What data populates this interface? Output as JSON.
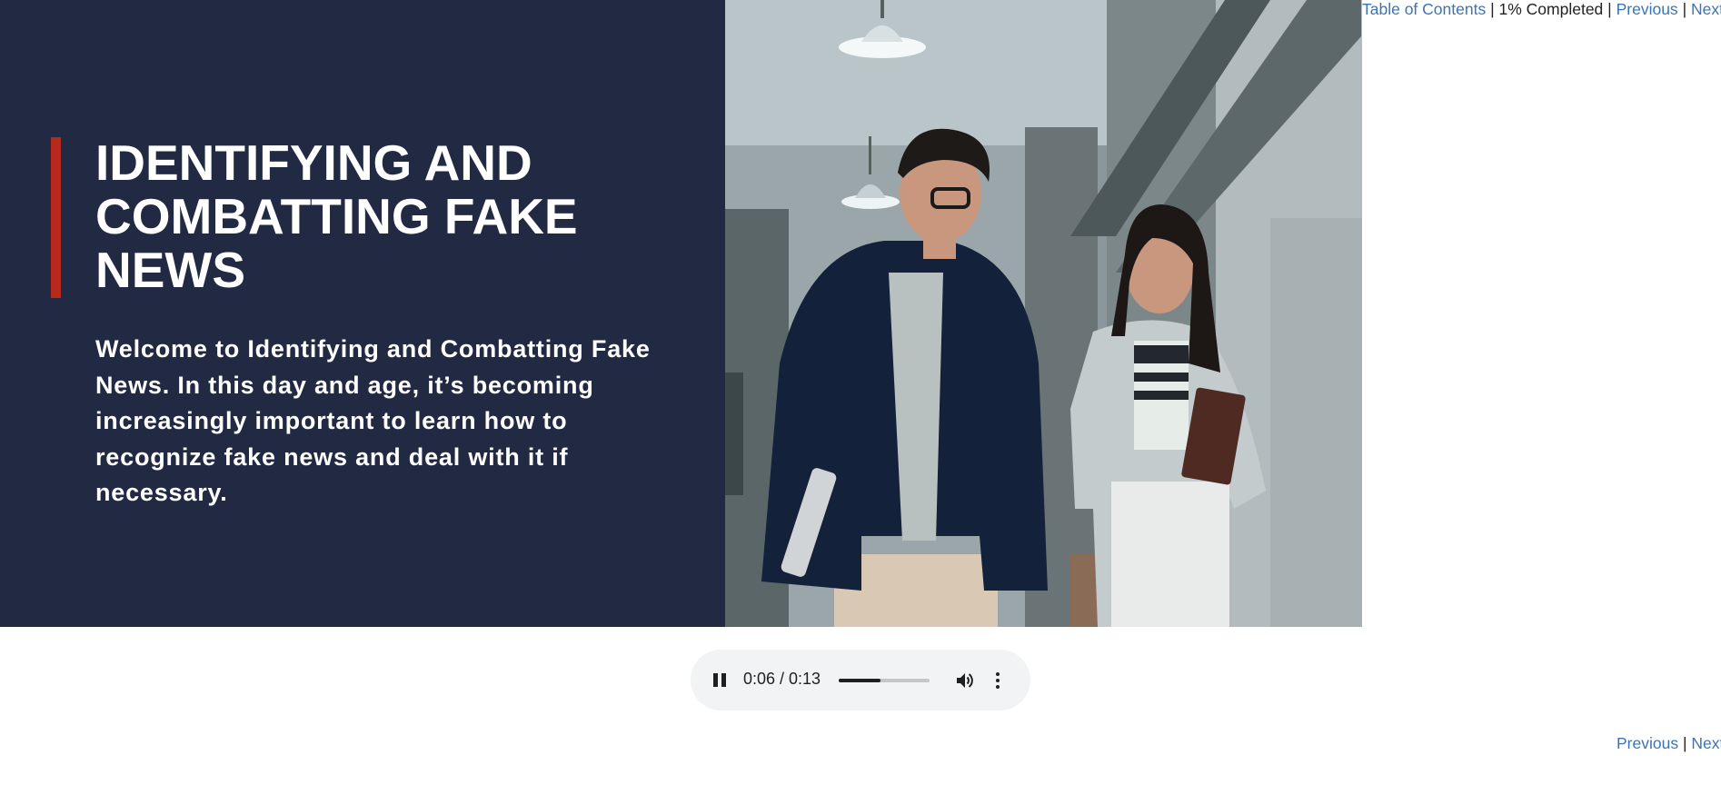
{
  "nav": {
    "table_of_contents": "Table of Contents",
    "progress": "1% Completed",
    "previous": "Previous",
    "next": "Next",
    "separator": "|"
  },
  "slide": {
    "title": "IDENTIFYING AND COMBATTING FAKE NEWS",
    "intro": "Welcome to Identifying and Combatting Fake News. In this day and age, it’s becoming increasingly important to learn how to recognize fake news and deal with it if necessary.",
    "panel_color": "#222943",
    "accent_color": "#b8291c"
  },
  "audio": {
    "time": "0:06 / 0:13",
    "progress_fraction": 0.46,
    "state": "playing"
  },
  "icons": {
    "pause": "pause-icon",
    "volume": "volume-icon",
    "more": "more-vert-icon"
  }
}
